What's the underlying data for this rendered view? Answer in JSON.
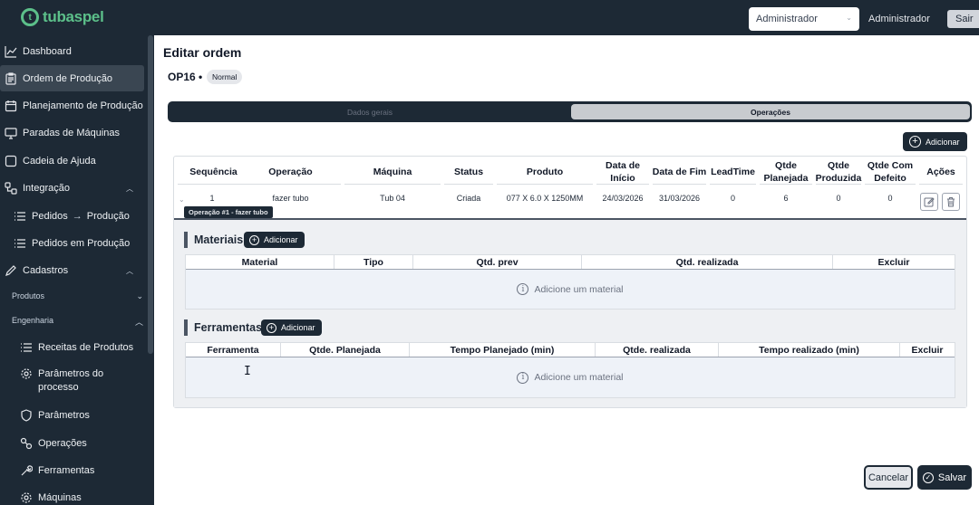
{
  "brand": {
    "name": "tubaspel"
  },
  "topbar": {
    "role_select": "Administrador",
    "user_name": "Administrador",
    "exit_label": "Sair"
  },
  "sidebar": {
    "items": [
      {
        "label": "Dashboard",
        "icon": "chart-line-icon"
      },
      {
        "label": "Ordem de Produção",
        "icon": "clipboard-icon",
        "active": true
      },
      {
        "label": "Planejamento de Produção",
        "icon": "calendar-icon"
      },
      {
        "label": "Paradas de Máquinas",
        "icon": "monitor-icon"
      },
      {
        "label": "Cadeia de Ajuda",
        "icon": "help-chat-icon"
      },
      {
        "label": "Integração",
        "icon": "integration-icon"
      },
      {
        "label": "Pedidos",
        "label2": "Produção",
        "icon": "list-icon"
      },
      {
        "label": "Pedidos em Produção",
        "icon": "list-icon"
      },
      {
        "label": "Cadastros",
        "icon": "pencil-icon"
      },
      {
        "label": "Receitas de Produtos",
        "icon": "list-icon"
      },
      {
        "label": "Parâmetros do processo",
        "icon": "gear-icon"
      },
      {
        "label": "Parâmetros",
        "icon": "shield-icon"
      },
      {
        "label": "Operações",
        "icon": "operations-icon"
      },
      {
        "label": "Ferramentas",
        "icon": "wrench-icon"
      },
      {
        "label": "Máquinas",
        "icon": "gear-icon"
      }
    ],
    "sections": {
      "produtos": "Produtos",
      "engenharia": "Engenharia"
    }
  },
  "page": {
    "title": "Editar ordem",
    "op_code": "OP16 •",
    "priority": "Normal",
    "tabs": [
      "Dados gerais",
      "Operações"
    ],
    "add_label": "Adicionar"
  },
  "operations_table": {
    "headers": [
      "Sequência",
      "Operação",
      "Máquina",
      "Status",
      "Produto",
      "Data de Início",
      "Data de Fim",
      "LeadTime",
      "Qtde Planejada",
      "Qtde Produzida",
      "Qtde Com Defeito",
      "Ações"
    ],
    "row": {
      "sequencia": "1",
      "operacao": "fazer tubo",
      "maquina": "Tub 04",
      "status": "Criada",
      "produto": "077 X 6.0 X 1250MM",
      "inicio": "24/03/2026",
      "fim": "31/03/2026",
      "leadtime": "0",
      "planejada": "6",
      "produzida": "0",
      "defeito": "0"
    },
    "tooltip": "Operação #1 - fazer tubo"
  },
  "materiais": {
    "title": "Materiais",
    "add_label": "Adicionar",
    "headers": [
      "Material",
      "Tipo",
      "Qtd. prev",
      "Qtd. realizada",
      "Excluir"
    ],
    "empty_text": "Adicione um material"
  },
  "ferramentas": {
    "title": "Ferramentas",
    "add_label": "Adicionar",
    "headers": [
      "Ferramenta",
      "Qtde. Planejada",
      "Tempo Planejado (min)",
      "Qtde. realizada",
      "Tempo realizado (min)",
      "Excluir"
    ],
    "empty_text": "Adicione um material"
  },
  "footer": {
    "cancel_label": "Cancelar",
    "save_label": "Salvar"
  }
}
